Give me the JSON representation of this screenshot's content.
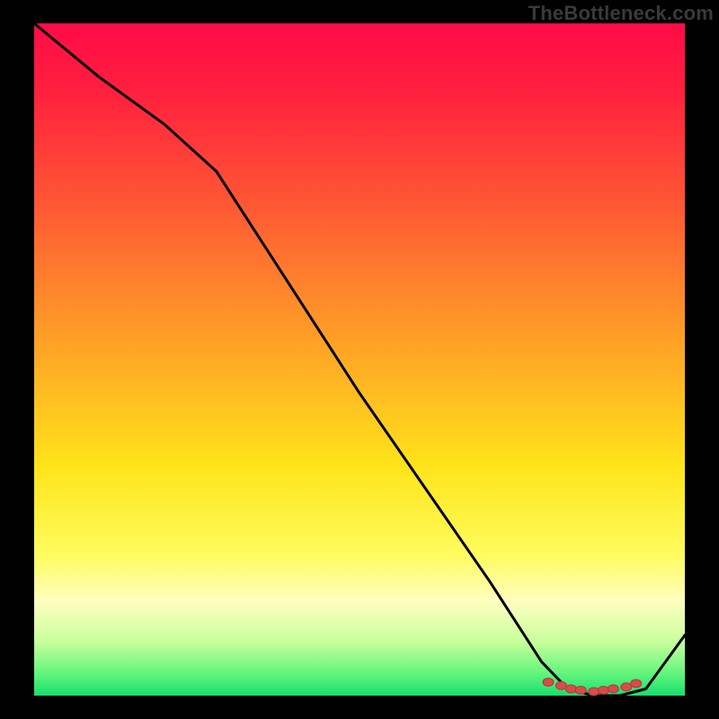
{
  "watermark": "TheBottleneck.com",
  "colors": {
    "background": "#000000",
    "line": "#000000",
    "points_fill": "#d94b4b",
    "points_stroke": "#b23636",
    "gradient_top": "#ff0b47",
    "gradient_bottom": "#17df6e",
    "watermark_text": "#3a3a3a"
  },
  "chart_data": {
    "type": "line",
    "title": "",
    "xlabel": "",
    "ylabel": "",
    "xlim": [
      0,
      100
    ],
    "ylim": [
      0,
      100
    ],
    "x": [
      0,
      10,
      20,
      28,
      40,
      50,
      60,
      70,
      78,
      82,
      86,
      90,
      94,
      100
    ],
    "values": [
      100,
      92,
      85,
      78,
      60,
      45,
      31,
      17,
      5,
      1,
      0,
      0,
      1,
      9
    ],
    "points": [
      {
        "x": 79,
        "y": 2
      },
      {
        "x": 81,
        "y": 1.5
      },
      {
        "x": 82.5,
        "y": 1
      },
      {
        "x": 84,
        "y": 0.8
      },
      {
        "x": 86,
        "y": 0.6
      },
      {
        "x": 87.5,
        "y": 0.8
      },
      {
        "x": 89,
        "y": 1
      },
      {
        "x": 91,
        "y": 1.3
      },
      {
        "x": 92.5,
        "y": 1.8
      }
    ]
  }
}
